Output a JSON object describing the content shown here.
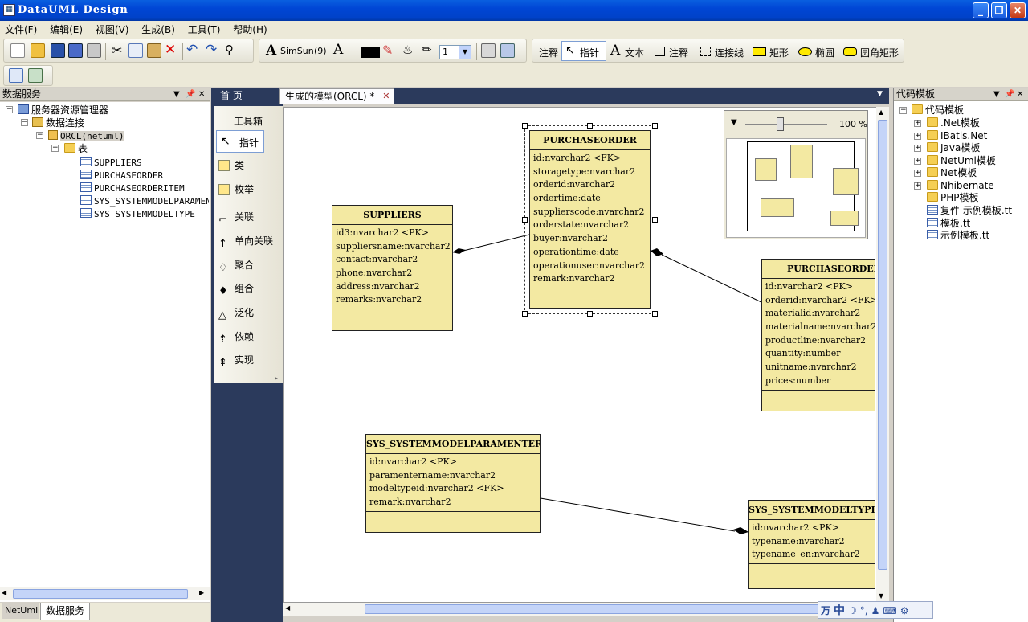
{
  "window": {
    "title": "DataUML Design"
  },
  "menu": [
    "文件(F)",
    "编辑(E)",
    "视图(V)",
    "生成(B)",
    "工具(T)",
    "帮助(H)"
  ],
  "toolbar": {
    "font_name": "SimSun",
    "font_size": "(9)",
    "line_width": "1",
    "diagram_tools": [
      "注释",
      "指针",
      "文本",
      "注释",
      "连接线",
      "矩形",
      "椭圆",
      "圆角矩形"
    ]
  },
  "left_panel": {
    "title": "数据服务",
    "tree": {
      "root": "服务器资源管理器",
      "connections": "数据连接",
      "db": "ORCL(netuml)",
      "tables_node": "表",
      "tables": [
        "SUPPLIERS",
        "PURCHASEORDER",
        "PURCHASEORDERITEM",
        "SYS_SYSTEMMODELPARAMENTER",
        "SYS_SYSTEMMODELTYPE"
      ]
    },
    "bottom_tabs": [
      "NetUml",
      "数据服务"
    ]
  },
  "doc_tabs": [
    "首 页",
    "生成的模型(ORCL) *"
  ],
  "toolbox": {
    "title": "工具箱",
    "items": [
      "指针",
      "类",
      "枚举",
      "关联",
      "单向关联",
      "聚合",
      "组合",
      "泛化",
      "依赖",
      "实现"
    ]
  },
  "overview": {
    "zoom": "100 %"
  },
  "entities": {
    "suppliers": {
      "name": "SUPPLIERS",
      "fields": [
        "id3:nvarchar2 <PK>",
        "suppliersname:nvarchar2",
        "contact:nvarchar2",
        "phone:nvarchar2",
        "address:nvarchar2",
        "remarks:nvarchar2"
      ]
    },
    "purchaseorder": {
      "name": "PURCHASEORDER",
      "fields": [
        "id:nvarchar2 <FK>",
        "storagetype:nvarchar2",
        "orderid:nvarchar2",
        "ordertime:date",
        "supplierscode:nvarchar2",
        "orderstate:nvarchar2",
        "buyer:nvarchar2",
        "operationtime:date",
        "operationuser:nvarchar2",
        "remark:nvarchar2"
      ]
    },
    "purchaseorderitem": {
      "name": "PURCHASEORDERITEM",
      "fields": [
        "id:nvarchar2 <PK>",
        "orderid:nvarchar2 <FK>",
        "materialid:nvarchar2",
        "materialname:nvarchar2",
        "productline:nvarchar2",
        "quantity:number",
        "unitname:nvarchar2",
        "prices:number"
      ]
    },
    "sysparam": {
      "name": "SYS_SYSTEMMODELPARAMENTER",
      "fields": [
        "id:nvarchar2 <PK>",
        "paramentername:nvarchar2",
        "modeltypeid:nvarchar2 <FK>",
        "remark:nvarchar2"
      ]
    },
    "systype": {
      "name": "SYS_SYSTEMMODELTYPE",
      "fields": [
        "id:nvarchar2 <PK>",
        "typename:nvarchar2",
        "typename_en:nvarchar2"
      ]
    }
  },
  "right_panel": {
    "title": "代码模板",
    "root": "代码模板",
    "folders": [
      ".Net模板",
      "IBatis.Net",
      "Java模板",
      "NetUml模板",
      "Net模板",
      "Nhibernate",
      "PHP模板"
    ],
    "files": [
      "复件 示例模板.tt",
      "模板.tt",
      "示例模板.tt"
    ]
  },
  "ime": {
    "labels": [
      "万",
      "中"
    ]
  }
}
